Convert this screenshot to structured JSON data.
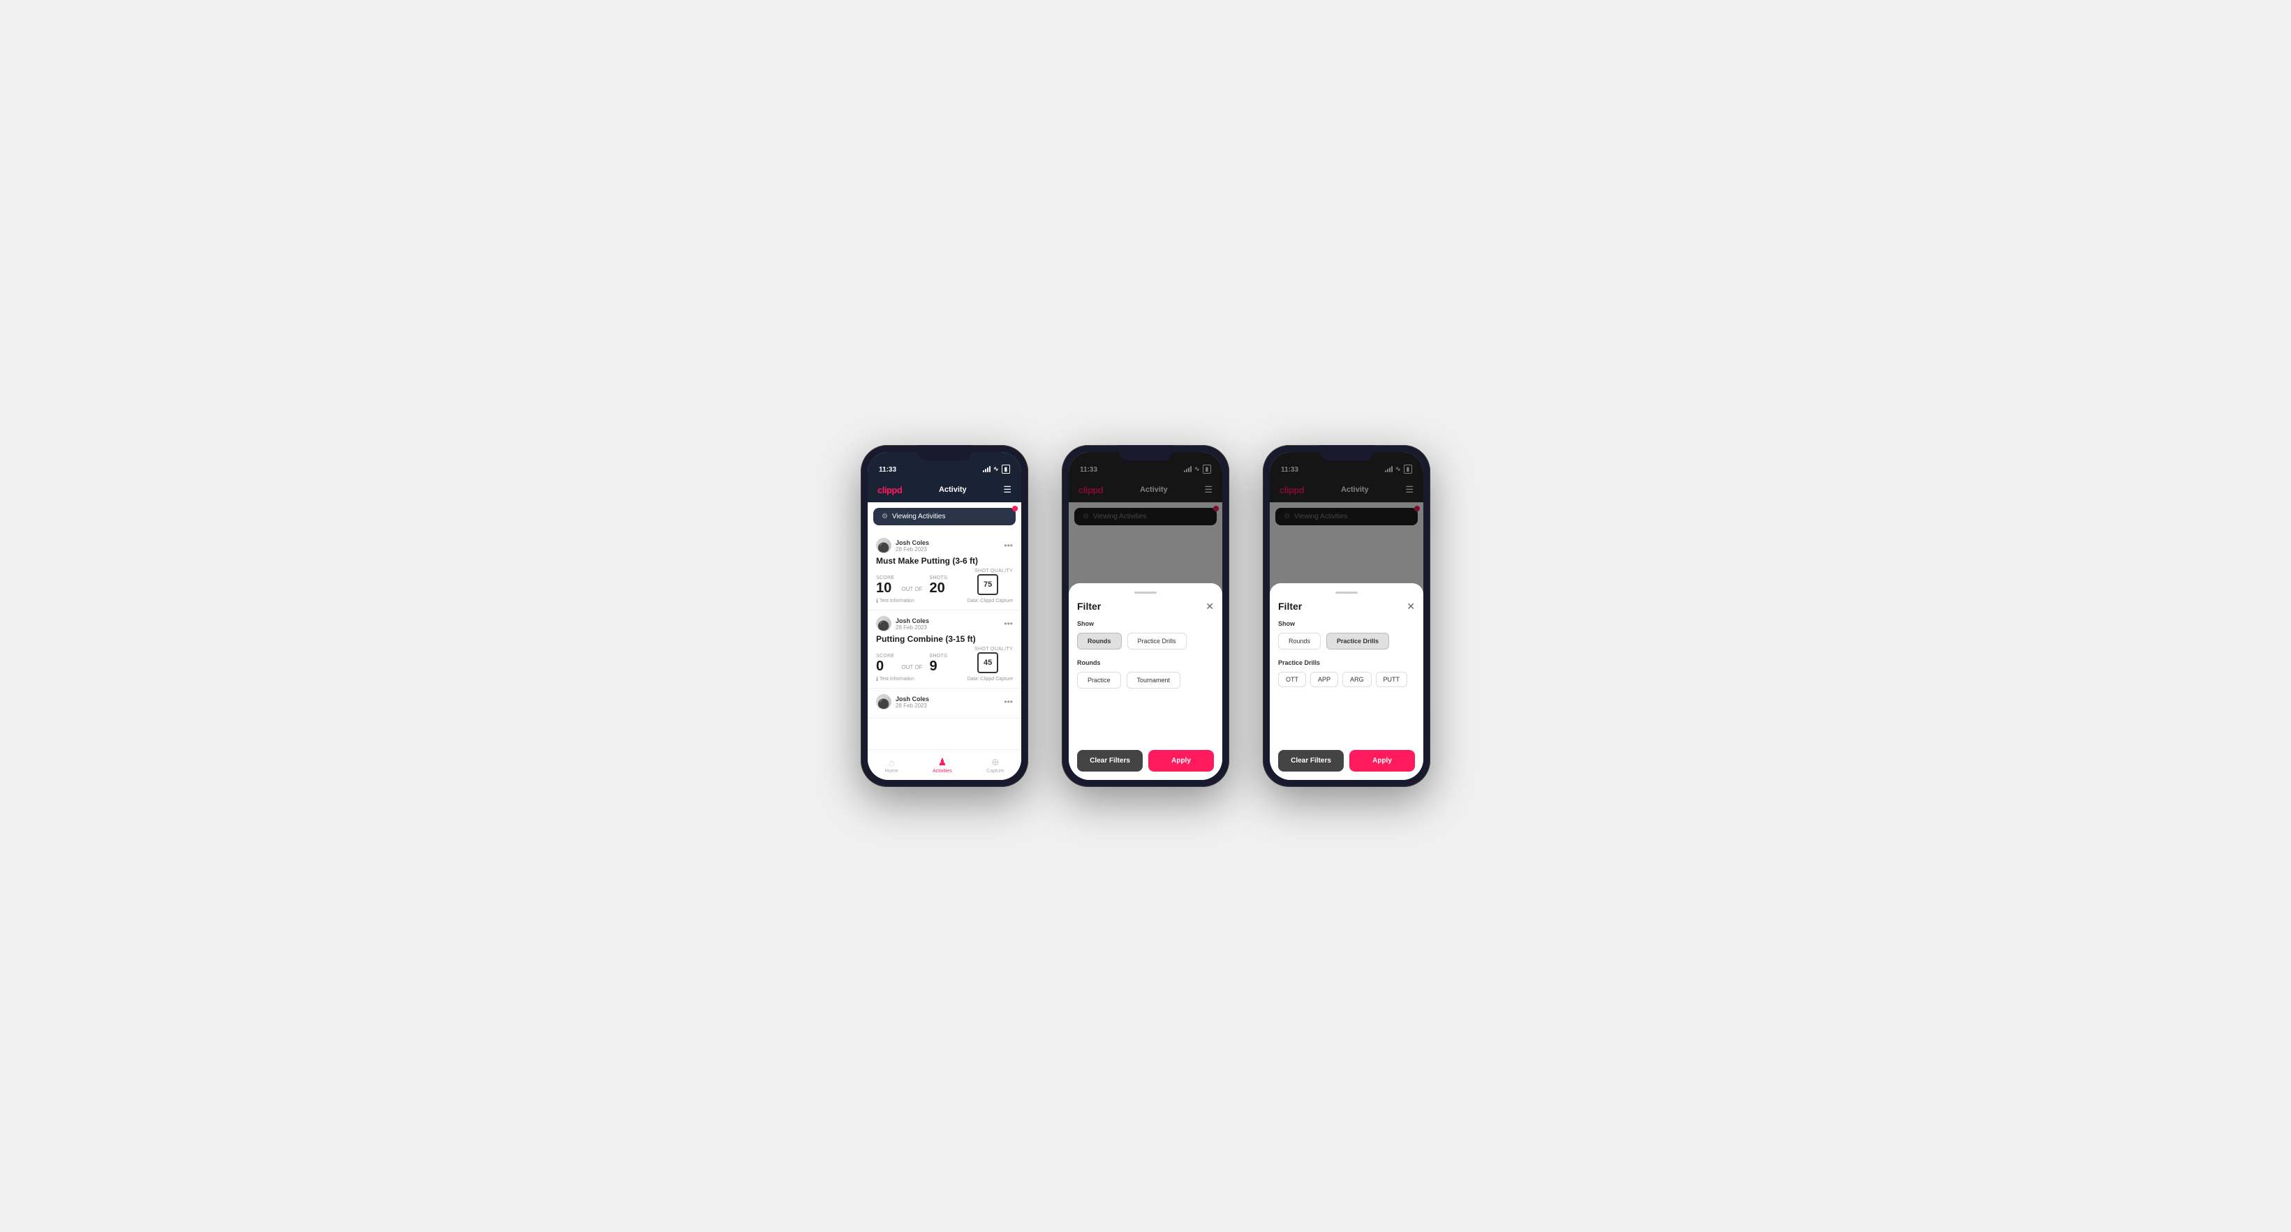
{
  "phones": [
    {
      "id": "phone1",
      "statusBar": {
        "time": "11:33"
      },
      "navBar": {
        "logo": "clippd",
        "title": "Activity"
      },
      "viewingBanner": {
        "text": "Viewing Activities",
        "hasDot": true
      },
      "cards": [
        {
          "user": "Josh Coles",
          "date": "28 Feb 2023",
          "title": "Must Make Putting (3-6 ft)",
          "score": "10",
          "outOf": "OUT OF",
          "total": "20",
          "scoreLabel": "Score",
          "shotsLabel": "Shots",
          "qualityLabel": "Shot Quality",
          "quality": "75",
          "footerLeft": "Test Information",
          "footerRight": "Data: Clippd Capture"
        },
        {
          "user": "Josh Coles",
          "date": "28 Feb 2023",
          "title": "Putting Combine (3-15 ft)",
          "score": "0",
          "outOf": "OUT OF",
          "total": "9",
          "scoreLabel": "Score",
          "shotsLabel": "Shots",
          "qualityLabel": "Shot Quality",
          "quality": "45",
          "footerLeft": "Test Information",
          "footerRight": "Data: Clippd Capture"
        }
      ],
      "bottomNav": [
        {
          "label": "Home",
          "icon": "⌂",
          "active": false
        },
        {
          "label": "Activities",
          "icon": "♂",
          "active": true
        },
        {
          "label": "Capture",
          "icon": "⊕",
          "active": false
        }
      ]
    },
    {
      "id": "phone2",
      "statusBar": {
        "time": "11:33"
      },
      "navBar": {
        "logo": "clippd",
        "title": "Activity"
      },
      "viewingBanner": {
        "text": "Viewing Activities",
        "hasDot": true
      },
      "filter": {
        "title": "Filter",
        "showLabel": "Show",
        "showButtons": [
          {
            "label": "Rounds",
            "active": true
          },
          {
            "label": "Practice Drills",
            "active": false
          }
        ],
        "roundsLabel": "Rounds",
        "roundButtons": [
          {
            "label": "Practice",
            "active": false
          },
          {
            "label": "Tournament",
            "active": false
          }
        ],
        "clearLabel": "Clear Filters",
        "applyLabel": "Apply"
      }
    },
    {
      "id": "phone3",
      "statusBar": {
        "time": "11:33"
      },
      "navBar": {
        "logo": "clippd",
        "title": "Activity"
      },
      "viewingBanner": {
        "text": "Viewing Activities",
        "hasDot": true
      },
      "filter": {
        "title": "Filter",
        "showLabel": "Show",
        "showButtons": [
          {
            "label": "Rounds",
            "active": false
          },
          {
            "label": "Practice Drills",
            "active": true
          }
        ],
        "practiceLabel": "Practice Drills",
        "practiceChips": [
          {
            "label": "OTT"
          },
          {
            "label": "APP"
          },
          {
            "label": "ARG"
          },
          {
            "label": "PUTT"
          }
        ],
        "clearLabel": "Clear Filters",
        "applyLabel": "Apply"
      }
    }
  ]
}
